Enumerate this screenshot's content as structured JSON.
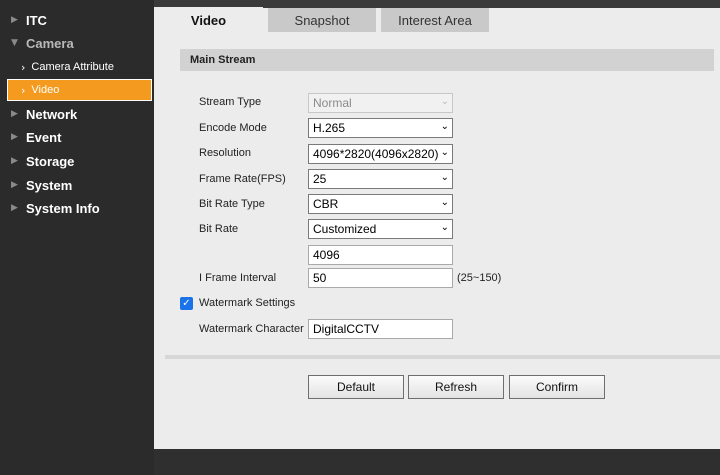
{
  "sidebar": {
    "items": [
      {
        "label": "ITC"
      },
      {
        "label": "Camera"
      },
      {
        "label": "Network"
      },
      {
        "label": "Event"
      },
      {
        "label": "Storage"
      },
      {
        "label": "System"
      },
      {
        "label": "System Info"
      }
    ],
    "sub_items": [
      {
        "label": "Camera Attribute"
      },
      {
        "label": "Video"
      }
    ]
  },
  "tabs": [
    {
      "label": "Video"
    },
    {
      "label": "Snapshot"
    },
    {
      "label": "Interest Area"
    }
  ],
  "section": {
    "title": "Main Stream"
  },
  "form": {
    "stream_type": {
      "label": "Stream Type",
      "value": "Normal"
    },
    "encode_mode": {
      "label": "Encode Mode",
      "value": "H.265"
    },
    "resolution": {
      "label": "Resolution",
      "value": "4096*2820(4096x2820)"
    },
    "frame_rate": {
      "label": "Frame Rate(FPS)",
      "value": "25"
    },
    "bit_rate_type": {
      "label": "Bit Rate Type",
      "value": "CBR"
    },
    "bit_rate": {
      "label": "Bit Rate",
      "value": "Customized",
      "custom_value": "4096"
    },
    "i_frame_interval": {
      "label": "I Frame Interval",
      "value": "50",
      "hint": "(25~150)"
    },
    "watermark_settings": {
      "label": "Watermark Settings",
      "checked": true
    },
    "watermark_character": {
      "label": "Watermark Character",
      "value": "DigitalCCTV"
    }
  },
  "buttons": {
    "default": "Default",
    "refresh": "Refresh",
    "confirm": "Confirm"
  },
  "colors": {
    "active_nav": "#f39a1f",
    "checkbox": "#1a73e8",
    "panel": "#ececec",
    "sidebar": "#2b2b2b"
  }
}
